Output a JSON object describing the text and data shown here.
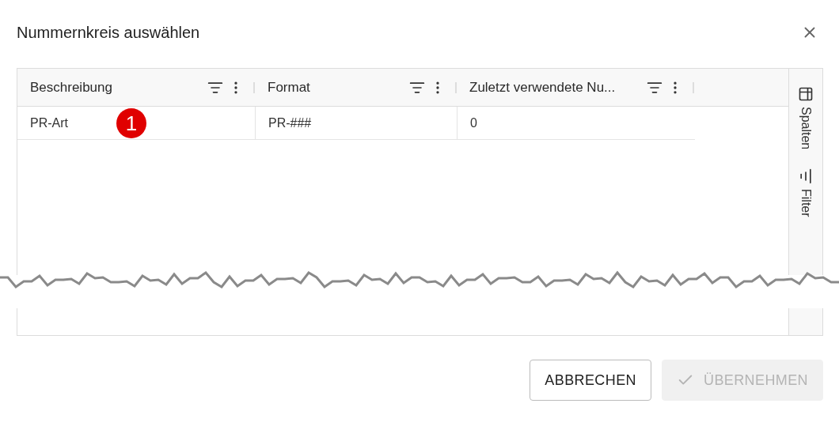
{
  "dialog": {
    "title": "Nummernkreis auswählen"
  },
  "table": {
    "columns": [
      {
        "label": "Beschreibung"
      },
      {
        "label": "Format"
      },
      {
        "label": "Zuletzt verwendete Nu..."
      }
    ],
    "rows": [
      {
        "cells": [
          "PR-Art",
          "PR-###",
          "0"
        ],
        "callout": "1"
      }
    ]
  },
  "side_panel": [
    {
      "kind": "columns",
      "label": "Spalten"
    },
    {
      "kind": "filter",
      "label": "Filter"
    }
  ],
  "buttons": [
    {
      "kind": "cancel",
      "label": "ABBRECHEN",
      "disabled": false
    },
    {
      "kind": "apply",
      "label": "ÜBERNEHMEN",
      "disabled": true
    }
  ]
}
